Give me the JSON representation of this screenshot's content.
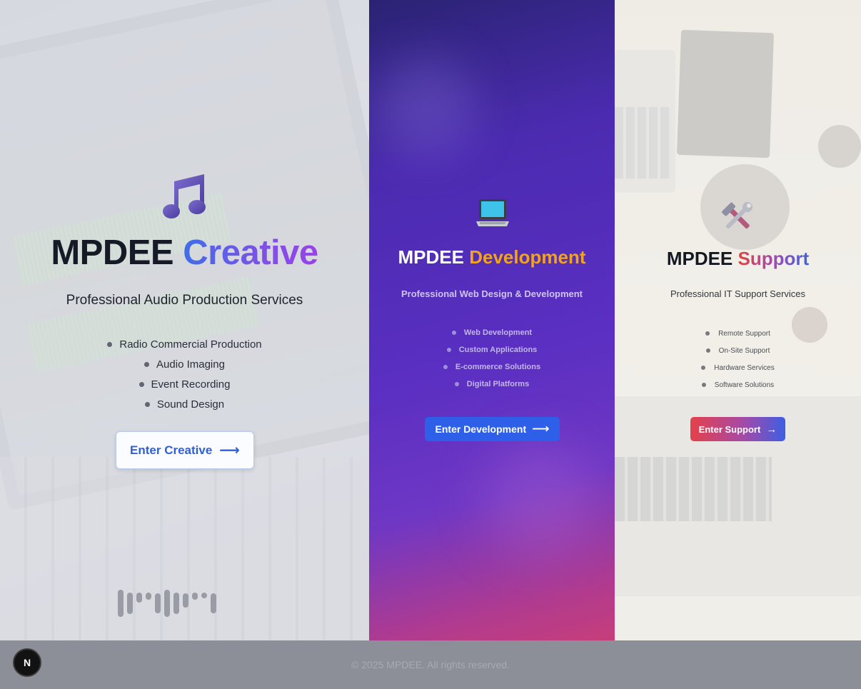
{
  "creative": {
    "icon": "music-note-icon",
    "title_main": "MPDEE",
    "title_accent": "Creative",
    "subtitle": "Professional Audio Production Services",
    "services": [
      "Radio Commercial Production",
      "Audio Imaging",
      "Event Recording",
      "Sound Design"
    ],
    "button_label": "Enter Creative",
    "button_arrow": "⟶",
    "accent_colors": [
      "#3f6ee8",
      "#9a42e9"
    ]
  },
  "development": {
    "icon": "laptop-icon",
    "title_main": "MPDEE",
    "title_accent": "Development",
    "subtitle": "Professional Web Design & Development",
    "services": [
      "Web Development",
      "Custom Applications",
      "E-commerce Solutions",
      "Digital Platforms"
    ],
    "button_label": "Enter Development",
    "button_arrow": "⟶",
    "accent_color": "#f2a317",
    "button_color": "#2d5fe8"
  },
  "support": {
    "icon": "hammer-wrench-icon",
    "title_main": "MPDEE",
    "title_accent": "Support",
    "subtitle": "Professional IT Support Services",
    "services": [
      "Remote Support",
      "On-Site Support",
      "Hardware Services",
      "Software Solutions"
    ],
    "button_label": "Enter Support",
    "button_arrow": "→",
    "accent_colors": [
      "#e0453f",
      "#3e63dc"
    ]
  },
  "footer": {
    "copyright": "© 2025 MPDEE. All rights reserved.",
    "badge_letter": "N"
  }
}
